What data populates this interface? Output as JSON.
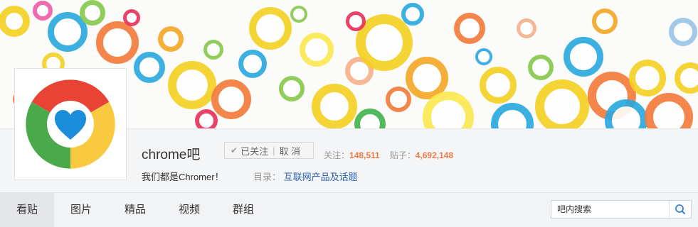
{
  "forum": {
    "name": "chrome吧",
    "slogan": "我们都是Chromer！"
  },
  "follow_button": {
    "check_glyph": "✔",
    "followed_label": "已关注",
    "divider": "|",
    "cancel_label": "取 消"
  },
  "stats": {
    "followers_label": "关注：",
    "followers_value": "148,511",
    "posts_label": "贴子：",
    "posts_value": "4,692,148"
  },
  "directory": {
    "label": "目录：",
    "value": "互联网产品及话题"
  },
  "nav": {
    "tabs": [
      {
        "label": "看贴",
        "active": true
      },
      {
        "label": "图片",
        "active": false
      },
      {
        "label": "精品",
        "active": false
      },
      {
        "label": "视频",
        "active": false
      },
      {
        "label": "群组",
        "active": false
      }
    ]
  },
  "search": {
    "placeholder": "吧内搜索",
    "icon": "search-icon"
  },
  "colors": {
    "accent_number": "#f07a48",
    "link_blue": "#2d64b3",
    "chrome_red": "#e84335",
    "chrome_green": "#4aa94a",
    "chrome_yellow": "#f9c940",
    "chrome_blue": "#1b8ddb"
  }
}
